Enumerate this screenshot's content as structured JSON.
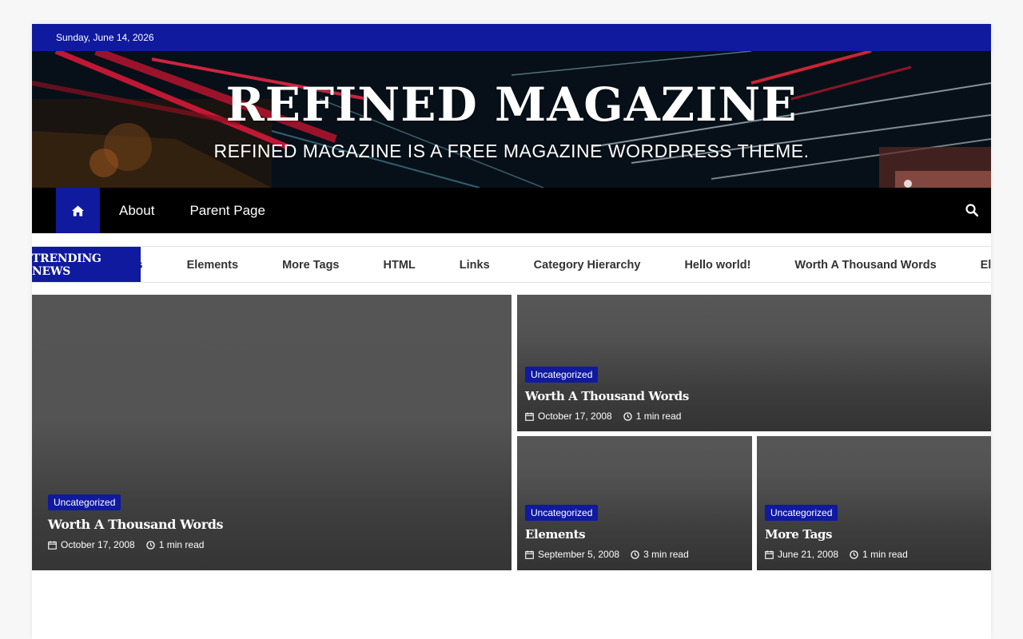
{
  "topbar": {
    "date": "Sunday, June 14, 2026"
  },
  "site": {
    "title": "REFINED MAGAZINE",
    "tagline": "REFINED MAGAZINE IS A FREE MAGAZINE WORDPRESS THEME."
  },
  "nav": {
    "home_icon": "home-icon",
    "items": [
      {
        "label": "About"
      },
      {
        "label": "Parent Page"
      }
    ],
    "search_icon": "search-icon"
  },
  "ticker": {
    "label": "TRENDING NEWS",
    "items": [
      "rds",
      "Elements",
      "More Tags",
      "HTML",
      "Links",
      "Category Hierarchy",
      "Hello world!",
      "Worth A Thousand Words",
      "Elem"
    ]
  },
  "cards": [
    {
      "category": "Uncategorized",
      "title": "Worth A Thousand Words",
      "date": "October 17, 2008",
      "read": "1 min read"
    },
    {
      "category": "Uncategorized",
      "title": "Worth A Thousand Words",
      "date": "October 17, 2008",
      "read": "1 min read"
    },
    {
      "category": "Uncategorized",
      "title": "Elements",
      "date": "September 5, 2008",
      "read": "3 min read"
    },
    {
      "category": "Uncategorized",
      "title": "More Tags",
      "date": "June 21, 2008",
      "read": "1 min read"
    }
  ],
  "colors": {
    "accent": "#0f1a9e",
    "nav_bg": "#000000",
    "card_bg": "#3a3a3a"
  }
}
